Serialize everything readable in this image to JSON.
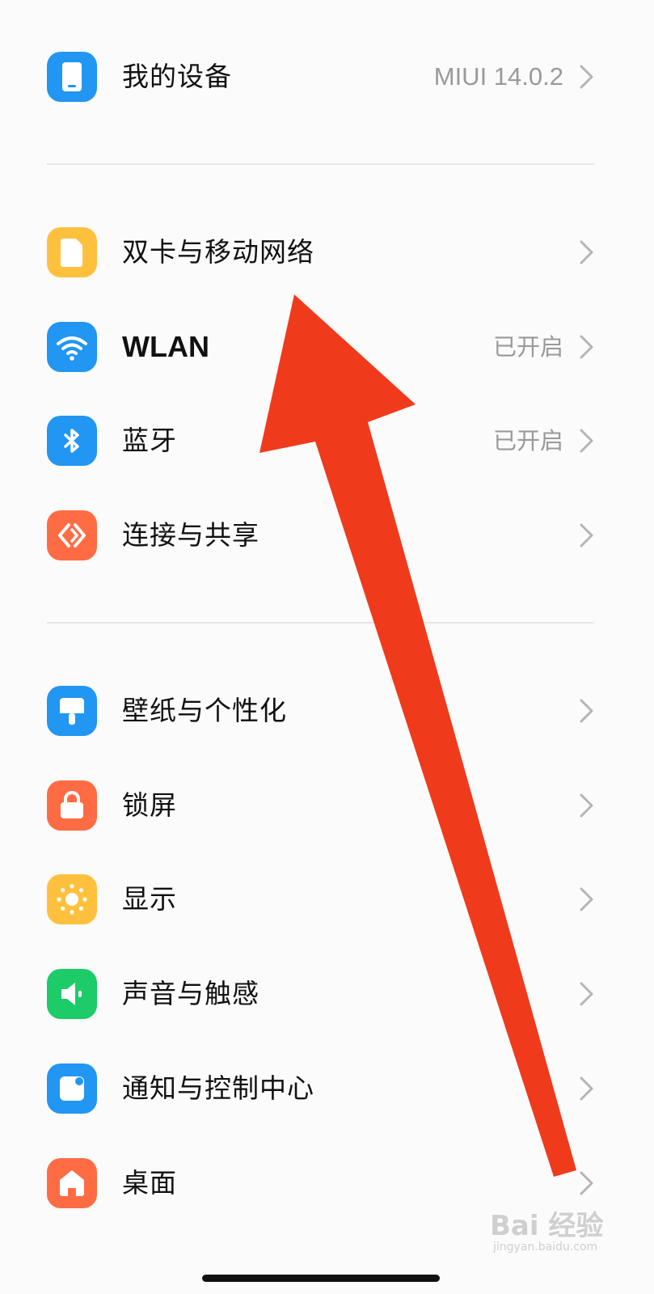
{
  "colors": {
    "blue": "#2196f3",
    "yellow": "#ffc13d",
    "orange": "#ff6c44",
    "green": "#1dcb68",
    "arrow": "#f03a1c"
  },
  "items": [
    {
      "label": "我的设备",
      "value": "MIUI 14.0.2",
      "icon": "phone-icon"
    },
    {
      "label": "双卡与移动网络",
      "value": "",
      "icon": "sim-card-icon"
    },
    {
      "label": "WLAN",
      "value": "已开启",
      "icon": "wifi-icon"
    },
    {
      "label": "蓝牙",
      "value": "已开启",
      "icon": "bluetooth-icon"
    },
    {
      "label": "连接与共享",
      "value": "",
      "icon": "share-connect-icon"
    },
    {
      "label": "壁纸与个性化",
      "value": "",
      "icon": "paint-brush-icon"
    },
    {
      "label": "锁屏",
      "value": "",
      "icon": "lock-icon"
    },
    {
      "label": "显示",
      "value": "",
      "icon": "sun-icon"
    },
    {
      "label": "声音与触感",
      "value": "",
      "icon": "speaker-icon"
    },
    {
      "label": "通知与控制中心",
      "value": "",
      "icon": "notification-icon"
    },
    {
      "label": "桌面",
      "value": "",
      "icon": "home-icon"
    }
  ],
  "watermark": {
    "main": "Bai 经验",
    "sub": "jingyan.baidu.com"
  }
}
